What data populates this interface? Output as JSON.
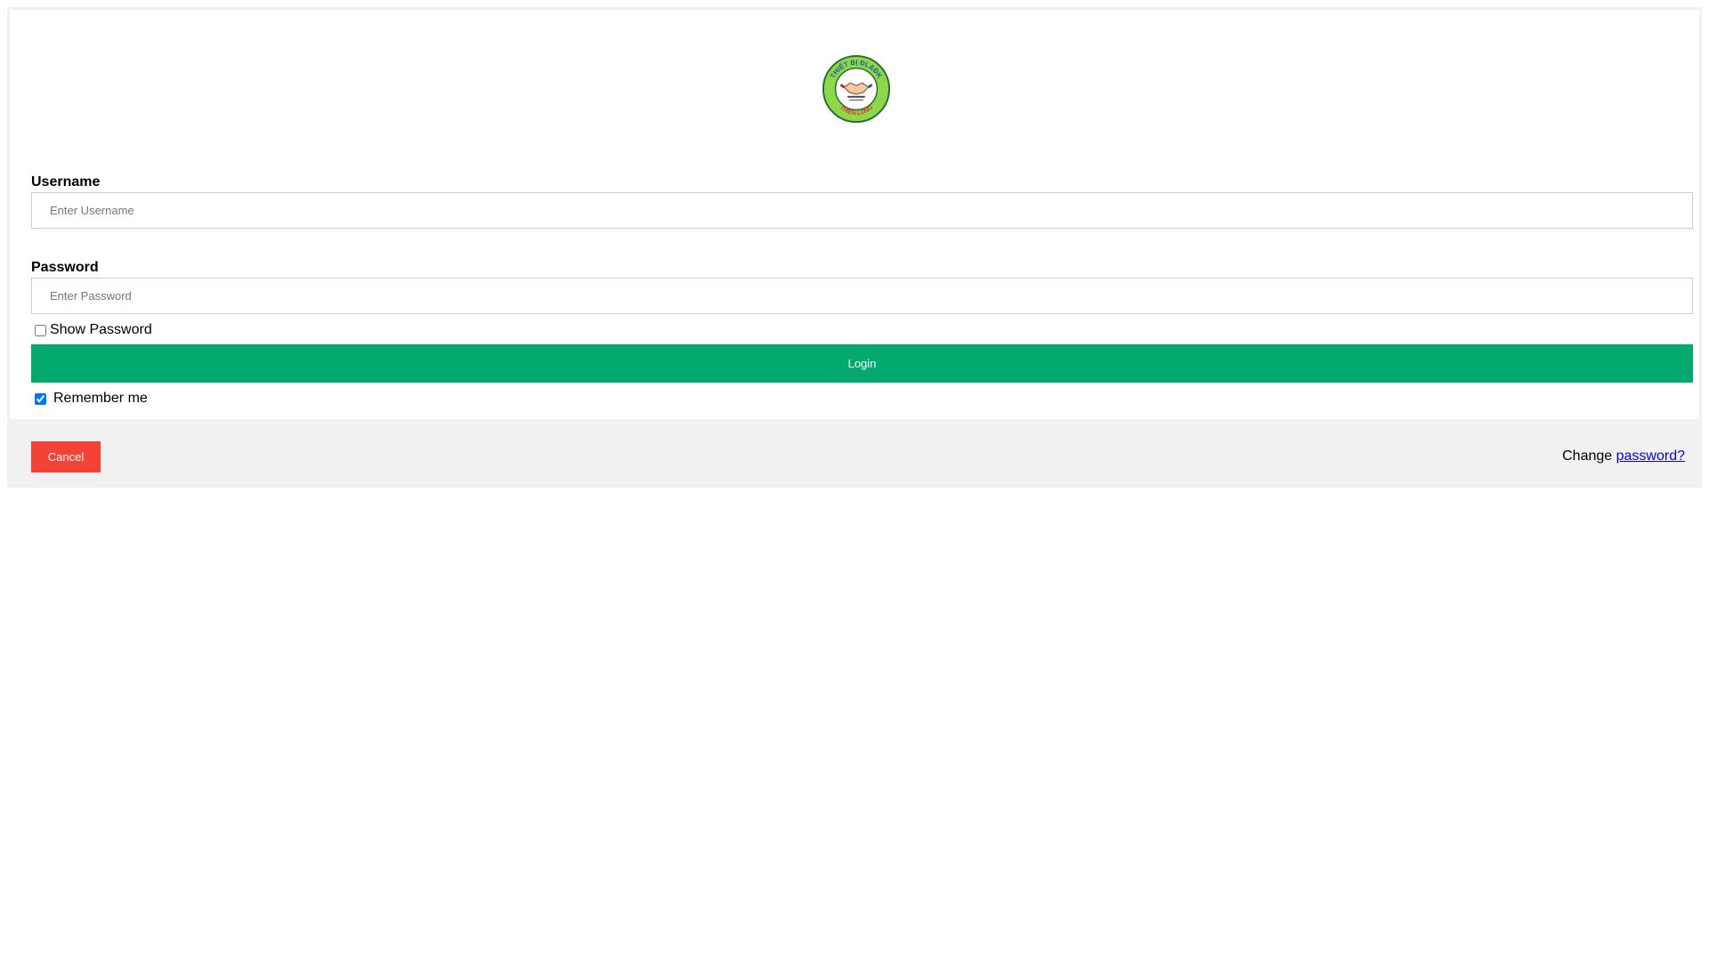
{
  "logo": {
    "icon": "handshake-emblem-icon",
    "ring_text_top": "THIẾT BỊ ĐL&ĐK",
    "ring_text_bottom": "THIÊN LONG",
    "colors": {
      "ring": "#8cd84a",
      "inner": "#ffffff",
      "border": "#2b6b2f",
      "accent": "#e53935"
    }
  },
  "form": {
    "username_label": "Username",
    "username_placeholder": "Enter Username",
    "password_label": "Password",
    "password_placeholder": "Enter Password",
    "show_password_label": "Show Password",
    "show_password_checked": false,
    "login_label": "Login",
    "remember_label": "Remember me",
    "remember_checked": true
  },
  "footer": {
    "cancel_label": "Cancel",
    "change_prefix": "Change ",
    "change_link": "password?"
  },
  "colors": {
    "login_button": "#04aa6d",
    "cancel_button": "#f44336",
    "footer_bg": "#f1f1f1",
    "link": "#0000ee"
  }
}
